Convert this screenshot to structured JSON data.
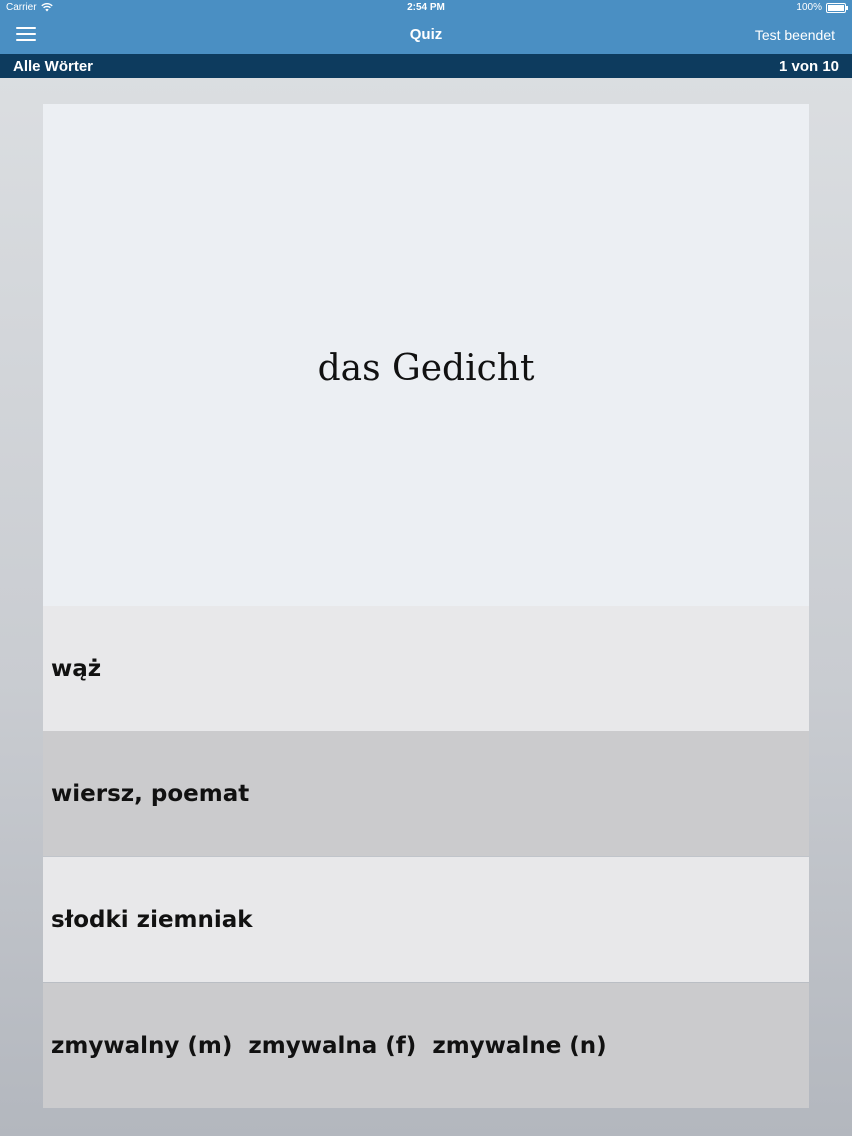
{
  "status_bar": {
    "carrier": "Carrier",
    "time": "2:54 PM",
    "battery": "100%"
  },
  "nav": {
    "title": "Quiz",
    "end_test_label": "Test beendet",
    "menu_icon": "hamburger-menu-icon"
  },
  "sub_header": {
    "category": "Alle Wörter",
    "progress": "1 von 10"
  },
  "quiz": {
    "question": "das Gedicht",
    "answers": [
      "wąż",
      "wiersz, poemat",
      "słodki ziemniak",
      "zmywalny (m)  zmywalna (f)  zmywalne (n)"
    ]
  },
  "colors": {
    "nav_blue": "#4a8fc3",
    "sub_header_navy": "#0d3b5e"
  }
}
